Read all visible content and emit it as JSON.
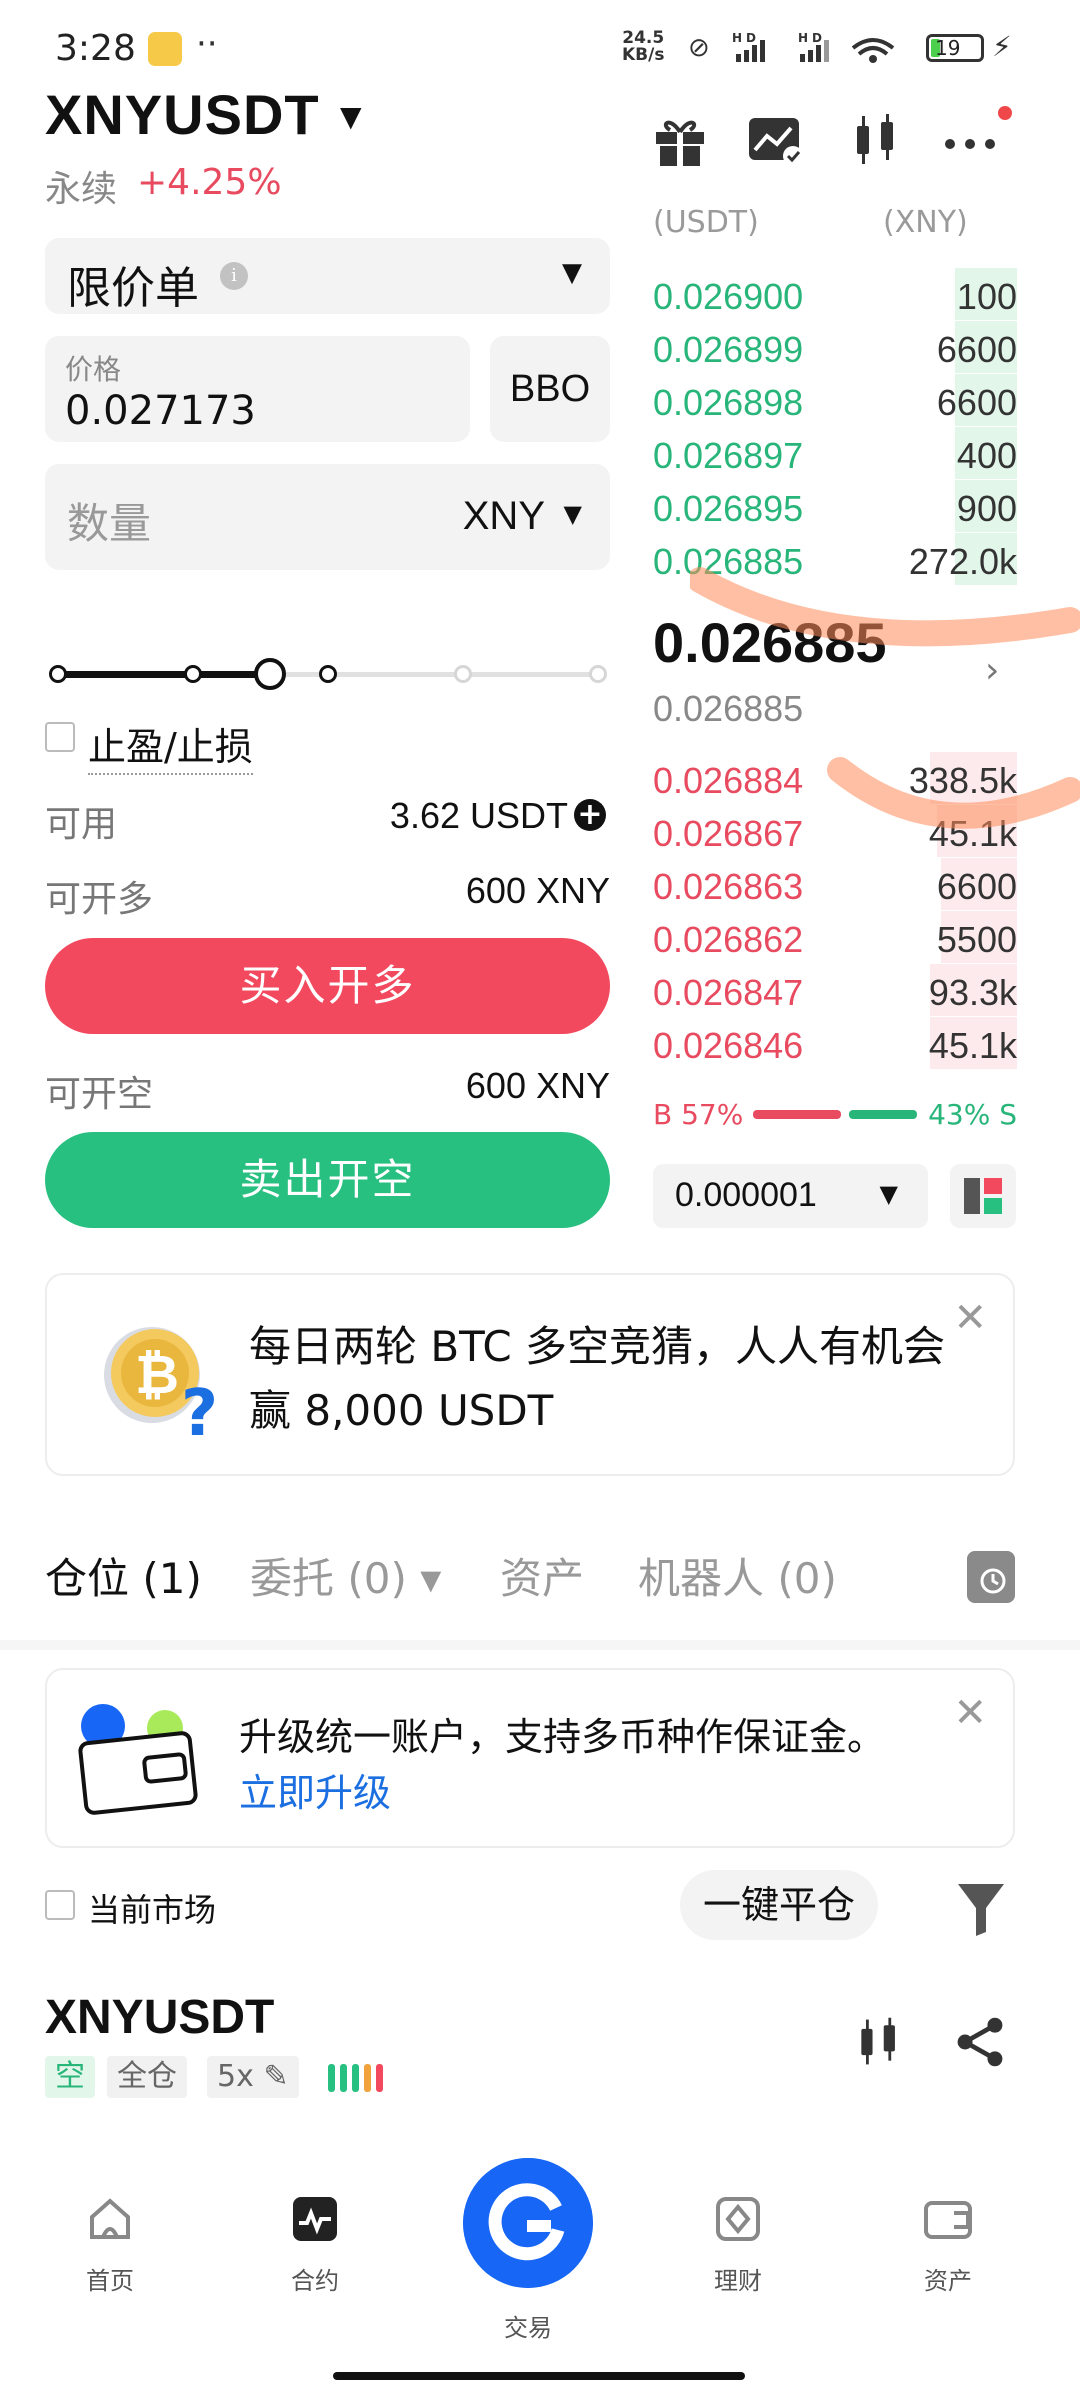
{
  "status_bar": {
    "time": "3:28",
    "speed_value": "24.5",
    "speed_unit": "KB/s",
    "battery": "19",
    "battery_level": 0.19
  },
  "header": {
    "pair": "XNYUSDT",
    "contract_type": "永续",
    "change": "+4.25%",
    "icons": [
      "gift-icon",
      "chart-check-icon",
      "candlestick-icon",
      "more-icon"
    ]
  },
  "order_form": {
    "order_type": "限价单",
    "price_label": "价格",
    "price_value": "0.027173",
    "bbo_label": "BBO",
    "qty_placeholder": "数量",
    "qty_unit": "XNY",
    "slider_level": 0.4,
    "tp_sl_label": "止盈/止损",
    "available_label": "可用",
    "available_value": "3.62 USDT",
    "can_long_label": "可开多",
    "can_long_value": "600 XNY",
    "buy_label": "买入开多",
    "can_short_label": "可开空",
    "can_short_value": "600 XNY",
    "sell_label": "卖出开空"
  },
  "orderbook": {
    "header_price": "(USDT)",
    "header_qty": "(XNY)",
    "asks": [
      {
        "price": "0.026900",
        "qty": "100",
        "depth": 0.17
      },
      {
        "price": "0.026899",
        "qty": "6600",
        "depth": 0.17
      },
      {
        "price": "0.026898",
        "qty": "6600",
        "depth": 0.17
      },
      {
        "price": "0.026897",
        "qty": "400",
        "depth": 0.17
      },
      {
        "price": "0.026895",
        "qty": "900",
        "depth": 0.17
      },
      {
        "price": "0.026885",
        "qty": "272.0k",
        "depth": 0.17
      }
    ],
    "last_price": "0.026885",
    "mark_price": "0.026885",
    "bids": [
      {
        "price": "0.026884",
        "qty": "338.5k",
        "depth": 0.24
      },
      {
        "price": "0.026867",
        "qty": "45.1k",
        "depth": 0.22
      },
      {
        "price": "0.026863",
        "qty": "6600",
        "depth": 0.21
      },
      {
        "price": "0.026862",
        "qty": "5500",
        "depth": 0.21
      },
      {
        "price": "0.026847",
        "qty": "93.3k",
        "depth": 0.24
      },
      {
        "price": "0.026846",
        "qty": "45.1k",
        "depth": 0.24
      }
    ],
    "buy_ratio": "B 57%",
    "sell_ratio": "43% S",
    "precision": "0.000001"
  },
  "promo": {
    "text": "每日两轮 BTC 多空竞猜，人人有机会赢 8,000 USDT"
  },
  "tabs": [
    {
      "label": "仓位 (1)"
    },
    {
      "label": "委托 (0) ▾"
    },
    {
      "label": "资产"
    },
    {
      "label": "机器人 (0)"
    }
  ],
  "upgrade": {
    "text": "升级统一账户，支持多币种作保证金。",
    "link": "立即升级"
  },
  "filters": {
    "current_market": "当前市场",
    "close_all": "一键平仓"
  },
  "position": {
    "pair": "XNYUSDT",
    "side": "空",
    "margin_mode": "全仓",
    "leverage": "5x"
  },
  "bottom_nav": [
    {
      "label": "首页"
    },
    {
      "label": "合约"
    },
    {
      "label": "交易"
    },
    {
      "label": "理财"
    },
    {
      "label": "资产"
    }
  ],
  "colors": {
    "buy": "#f2495e",
    "sell": "#28c080",
    "brand": "#1766f5"
  }
}
